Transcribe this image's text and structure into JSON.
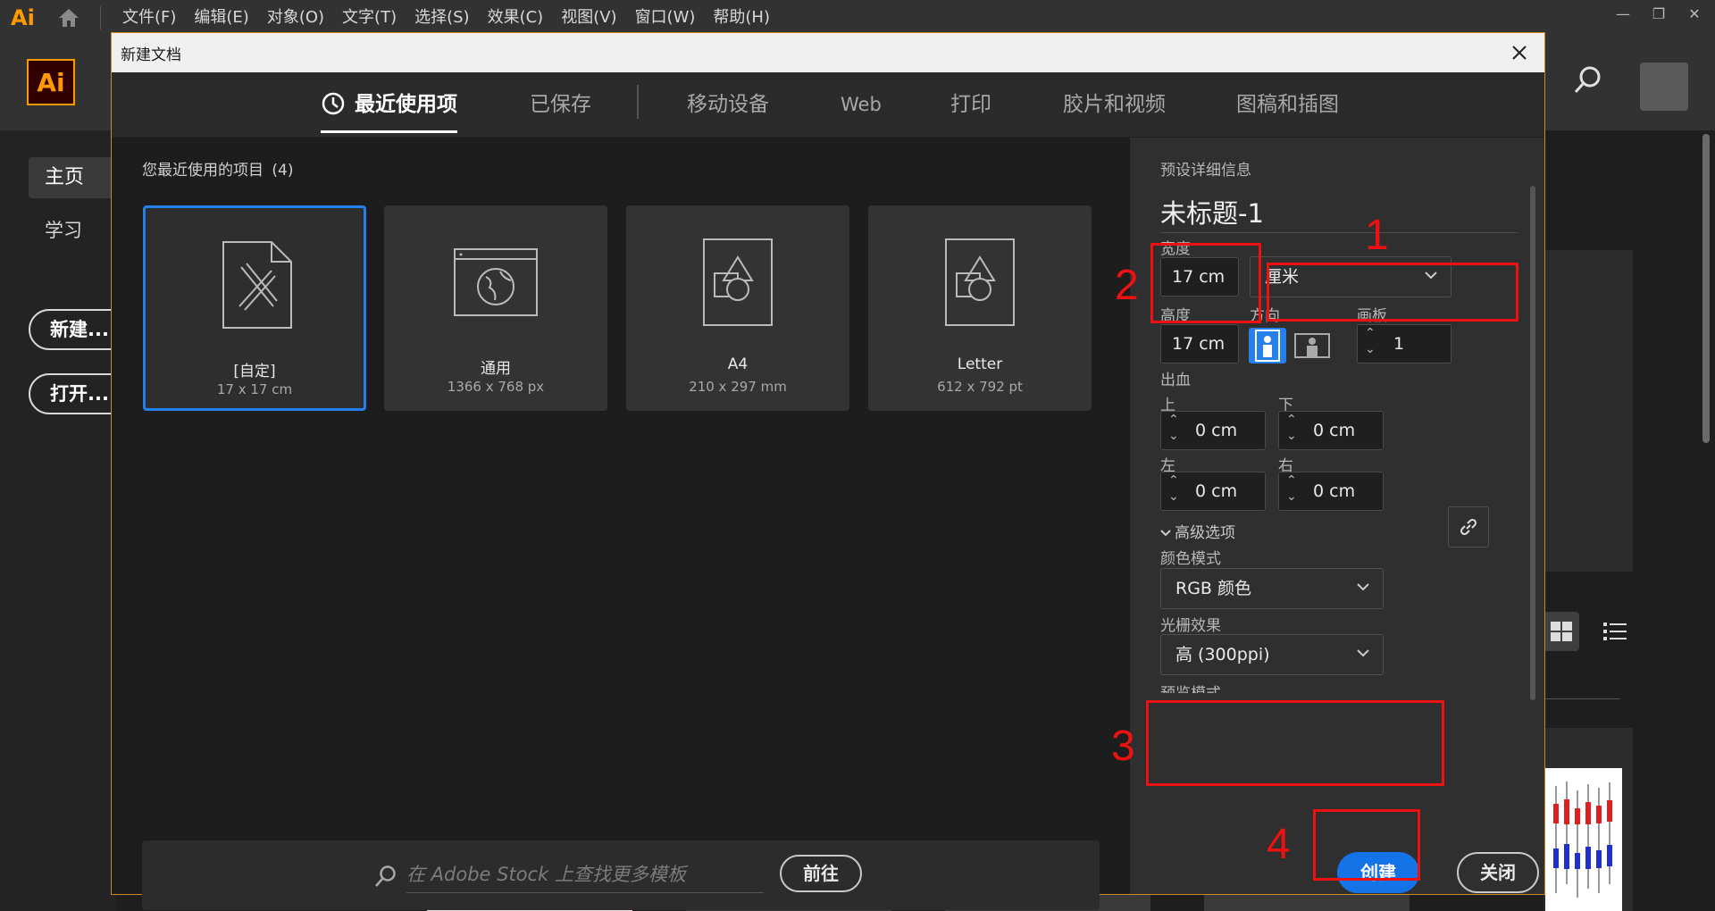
{
  "menubar": {
    "app_mark": "Ai",
    "items": [
      "文件(F)",
      "编辑(E)",
      "对象(O)",
      "文字(T)",
      "选择(S)",
      "效果(C)",
      "视图(V)",
      "窗口(W)",
      "帮助(H)"
    ]
  },
  "app": {
    "logo": "Ai",
    "nav": {
      "home": "主页",
      "learn": "学习",
      "new_button": "新建...",
      "open_button": "打开..."
    }
  },
  "dialog": {
    "title": "新建文档",
    "tabs": [
      "最近使用项",
      "已保存",
      "移动设备",
      "Web",
      "打印",
      "胶片和视频",
      "图稿和插图"
    ],
    "recent_label": "您最近使用的项目",
    "recent_count": "(4)",
    "cards": [
      {
        "name": "[自定]",
        "size": "17 x 17 cm",
        "icon": "custom-doc-icon"
      },
      {
        "name": "通用",
        "size": "1366 x 768 px",
        "icon": "web-doc-icon"
      },
      {
        "name": "A4",
        "size": "210 x 297 mm",
        "icon": "print-doc-icon"
      },
      {
        "name": "Letter",
        "size": "612 x 792 pt",
        "icon": "print-doc-icon"
      }
    ],
    "stock": {
      "placeholder": "在 Adobe Stock 上查找更多模板",
      "go_button": "前往"
    },
    "preset": {
      "header": "预设详细信息",
      "doc_name": "未标题-1",
      "width_label": "宽度",
      "width_value": "17 cm",
      "unit_value": "厘米",
      "height_label": "高度",
      "height_value": "17 cm",
      "orientation_label": "方向",
      "artboards_label": "画板",
      "artboards_value": "1",
      "bleed_label": "出血",
      "bleed_top_label": "上",
      "bleed_top": "0 cm",
      "bleed_bottom_label": "下",
      "bleed_bottom": "0 cm",
      "bleed_left_label": "左",
      "bleed_left": "0 cm",
      "bleed_right_label": "右",
      "bleed_right": "0 cm",
      "advanced_label": "高级选项",
      "color_mode_label": "颜色模式",
      "color_mode_value": "RGB 颜色",
      "raster_label": "光栅效果",
      "raster_value": "高 (300ppi)",
      "preview_label": "预览模式",
      "create_button": "创建",
      "close_button": "关闭"
    }
  },
  "annotations": [
    "1",
    "2",
    "3",
    "4"
  ],
  "colors": {
    "accent": "#1473e6",
    "selection": "#2680eb",
    "annotation": "#e11111",
    "ai_orange": "#ff9a00"
  }
}
